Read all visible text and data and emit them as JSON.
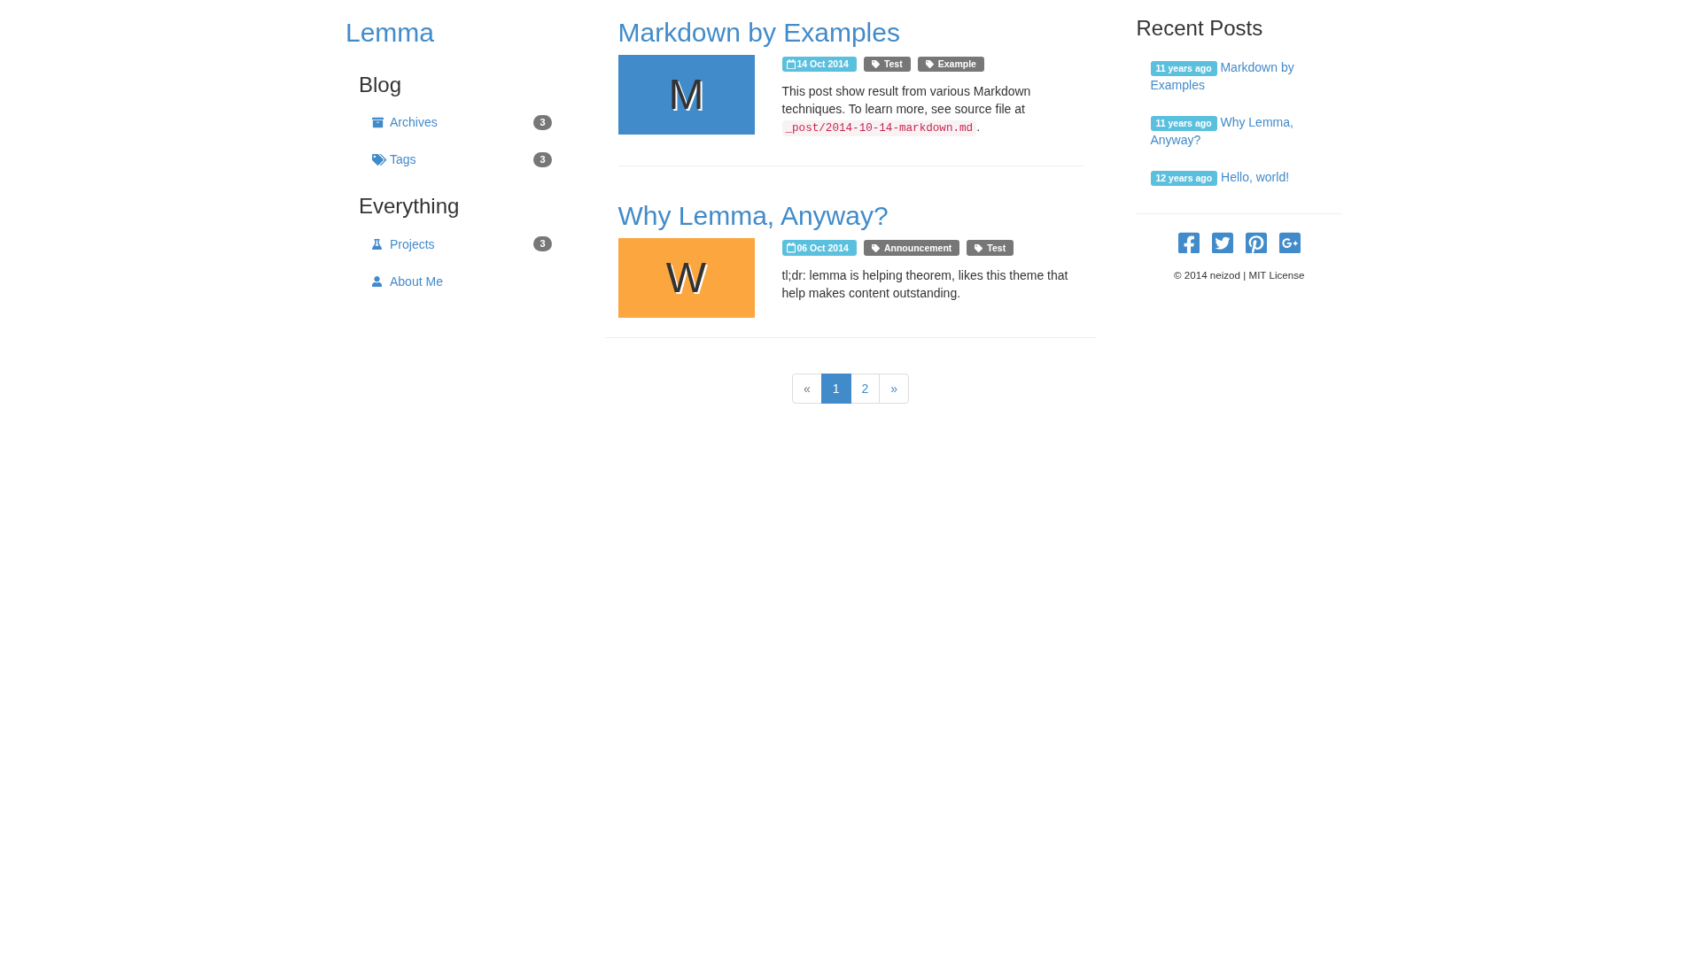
{
  "site": {
    "title": "Lemma"
  },
  "sidebar": {
    "sections": [
      {
        "heading": "Blog",
        "items": [
          {
            "label": "Archives",
            "count": "3"
          },
          {
            "label": "Tags",
            "count": "3"
          }
        ]
      },
      {
        "heading": "Everything",
        "items": [
          {
            "label": "Projects",
            "count": "3"
          },
          {
            "label": "About Me"
          }
        ]
      }
    ]
  },
  "posts": [
    {
      "title": "Markdown by Examples",
      "thumb": "M",
      "color": "#428bca",
      "date": "14 Oct 2014",
      "tags": [
        "Test",
        "Example"
      ],
      "excerpt": [
        {
          "kind": "text",
          "text": "This post show result from various Markdown techniques. To learn more, see source file at "
        },
        {
          "kind": "code",
          "text": "_post/2014-10-14-markdown.md"
        },
        {
          "kind": "text",
          "text": "."
        }
      ]
    },
    {
      "title": "Why Lemma, Anyway?",
      "thumb": "W",
      "color": "#fca640",
      "date": "06 Oct 2014",
      "tags": [
        "Announcement",
        "Test"
      ],
      "excerpt": [
        {
          "kind": "text",
          "text": "tl;dr: lemma is helping theorem, likes this theme that help makes content outstanding."
        }
      ]
    }
  ],
  "pagination": [
    {
      "label": "«",
      "selected": false,
      "disabled": true
    },
    {
      "label": "1",
      "selected": true,
      "disabled": false
    },
    {
      "label": "2",
      "selected": false,
      "disabled": false
    },
    {
      "label": "»",
      "selected": false,
      "disabled": false
    }
  ],
  "recent_posts": {
    "heading": "Recent Posts",
    "items": [
      {
        "age": "11 years ago",
        "title": "Markdown by Examples"
      },
      {
        "age": "11 years ago",
        "title": "Why Lemma, Anyway?"
      },
      {
        "age": "12 years ago",
        "title": "Hello, world!"
      }
    ]
  },
  "footer": {
    "text": "© 2014 neizod | MIT License"
  }
}
